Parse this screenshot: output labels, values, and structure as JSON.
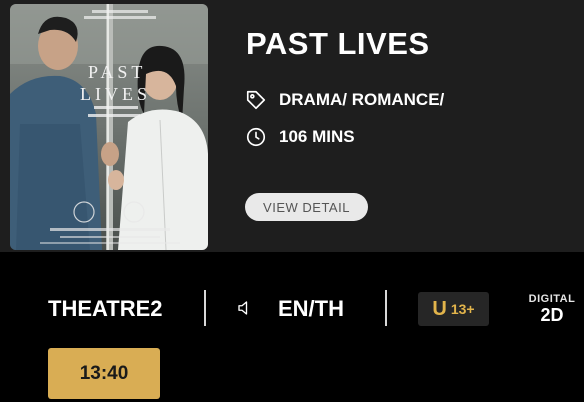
{
  "movie": {
    "title": "PAST LIVES",
    "genre": "DRAMA/ ROMANCE/",
    "duration": "106 MINS",
    "detail_button_label": "VIEW DETAIL"
  },
  "poster": {
    "title_line1": "PAST",
    "title_line2": "LIVES"
  },
  "session": {
    "theatre": "THEATRE2",
    "language": "EN/TH",
    "rating_letter": "U",
    "rating_age": "13+",
    "format_top": "DIGITAL",
    "format_bottom": "2D"
  },
  "showtimes": [
    "13:40"
  ],
  "icons": {
    "genre": "tag-icon",
    "duration": "clock-icon",
    "sound": "speaker-icon"
  },
  "colors": {
    "accent": "#d9ad54",
    "rating": "#e2b44b",
    "panel": "#1e1e1e"
  }
}
